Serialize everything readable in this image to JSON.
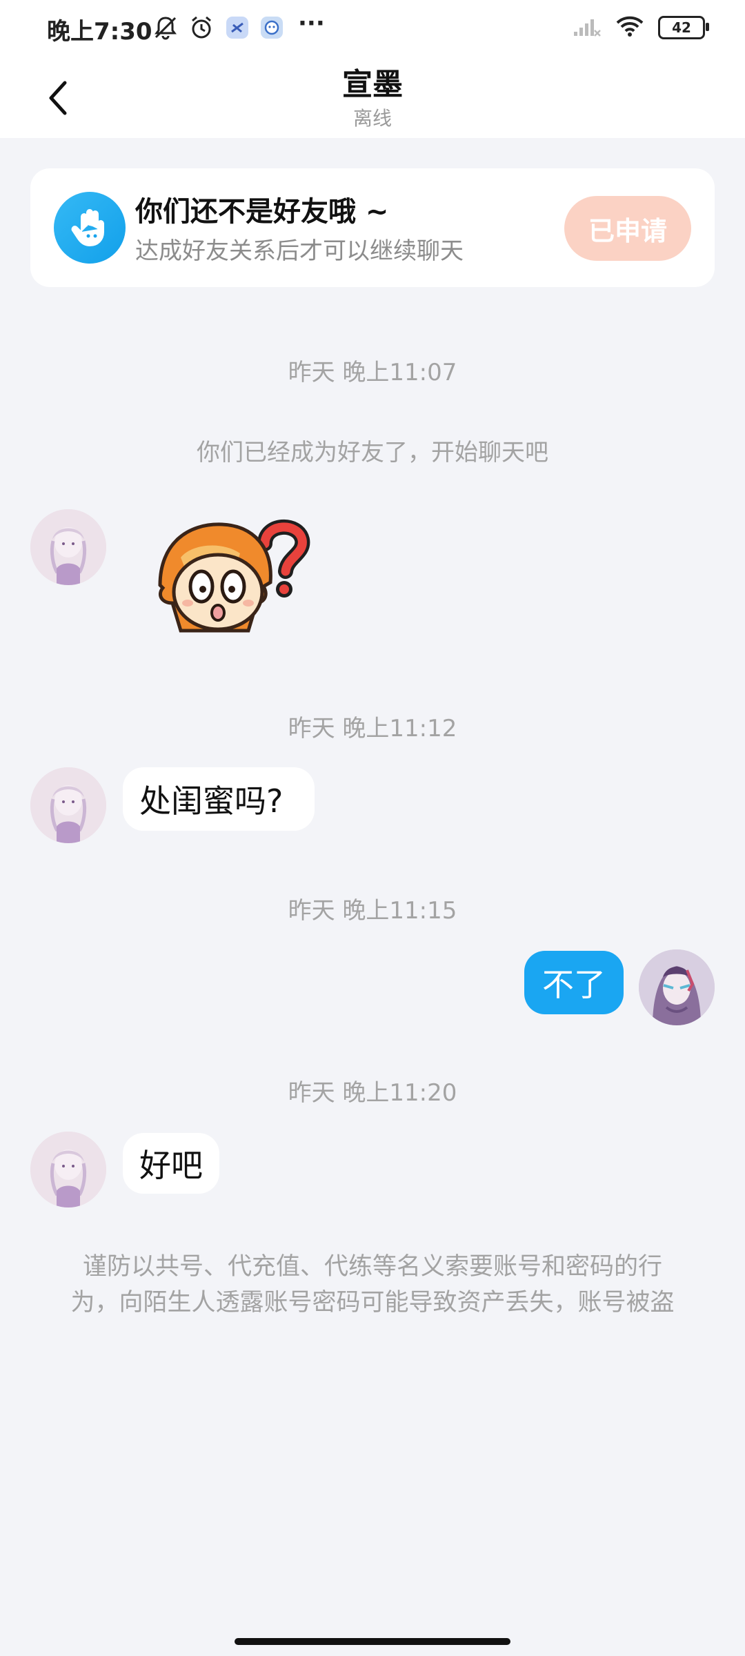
{
  "status_bar": {
    "time": "晚上7:30",
    "more": "···",
    "battery": "42",
    "icons": [
      "notifications-off-icon",
      "alarm-icon",
      "app-icon",
      "app-icon",
      "signal-icon",
      "wifi-icon",
      "battery-icon"
    ]
  },
  "header": {
    "title": "宣墨",
    "status": "离线"
  },
  "banner": {
    "title": "你们还不是好友哦 ~",
    "subtitle": "达成好友关系后才可以继续聊天",
    "button": "已申请",
    "icon": "wave-hand-icon"
  },
  "messages": {
    "t1": "昨天 晚上11:07",
    "system": "你们已经成为好友了，开始聊天吧",
    "t2": "昨天 晚上11:12",
    "m2": "处闺蜜吗?",
    "t3": "昨天 晚上11:15",
    "m3": "不了",
    "t4": "昨天 晚上11:20",
    "m4": "好吧"
  },
  "warning": "谨防以共号、代充值、代练等名义索要账号和密码的行为，向陌生人透露账号密码可能导致资产丢失，账号被盗",
  "colors": {
    "accent": "#1aa6f2",
    "applied_button": "#fbd2c4",
    "background": "#f3f4f8"
  }
}
